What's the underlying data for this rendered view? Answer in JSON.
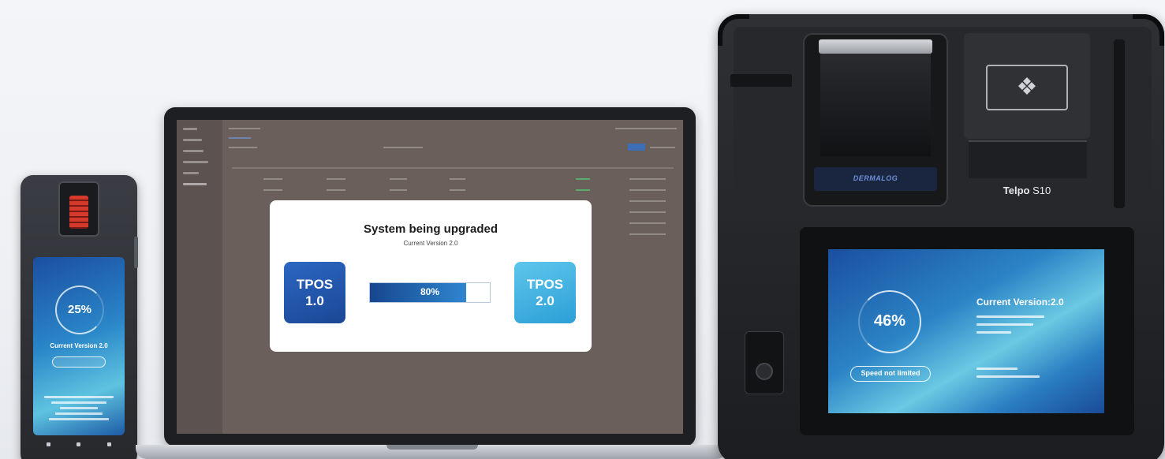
{
  "dialog": {
    "title": "System being upgraded",
    "subtitle": "Current Version 2.0",
    "from_version": {
      "name": "TPOS",
      "number": "1.0"
    },
    "to_version": {
      "name": "TPOS",
      "number": "2.0"
    },
    "progress_label": "80%",
    "progress_fraction": 0.8
  },
  "phone": {
    "percent_label": "25%",
    "version_label": "Current Version 2.0"
  },
  "tablet": {
    "model_brand": "Telpo",
    "model_number": "S10",
    "percent_label": "46%",
    "speed_label": "Speed not limited",
    "version_label": "Current Version:2.0"
  },
  "colors": {
    "progress_fill": "#1f5fae",
    "tpos_old": "#2c67c2",
    "tpos_new": "#5ec6ec",
    "laptop_screen_bg": "#6a5f5a"
  },
  "icons": {
    "nfc": "contactless-payment-icon",
    "fingerprint": "fingerprint-scanner-icon"
  }
}
